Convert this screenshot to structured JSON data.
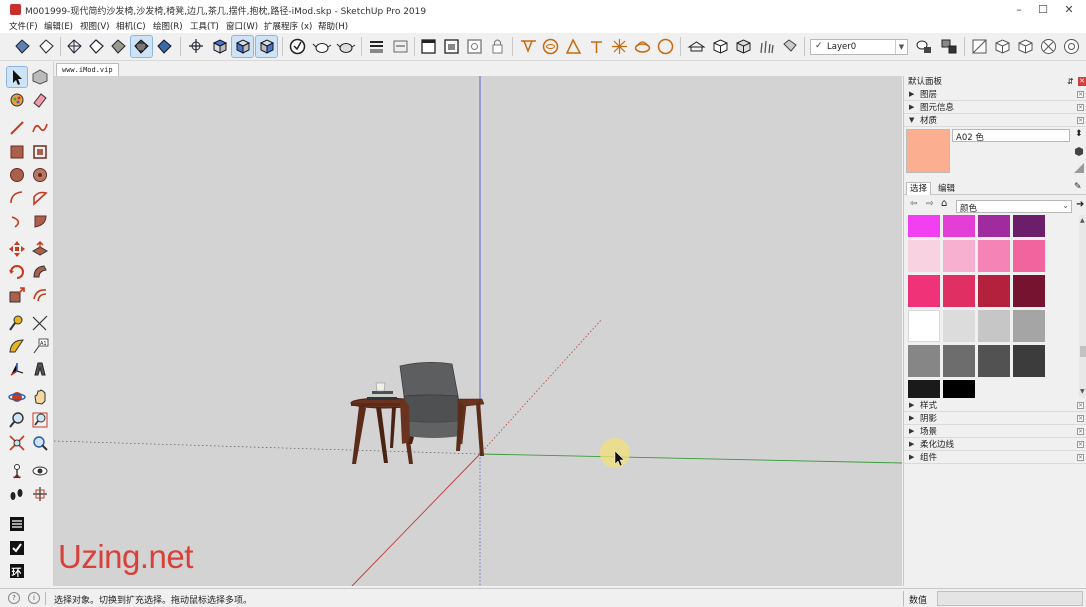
{
  "window": {
    "title": "M001999-现代简约沙发椅,沙发椅,椅凳,边几,茶几,摆件,抱枕,路径-iMod.skp - SketchUp Pro 2019",
    "minimize": "–",
    "maximize": "☐",
    "close": "✕"
  },
  "menu": [
    "文件(F)",
    "编辑(E)",
    "视图(V)",
    "相机(C)",
    "绘图(R)",
    "工具(T)",
    "窗口(W)",
    "扩展程序 (x)",
    "帮助(H)"
  ],
  "toolbar": {
    "layer_check": "✓",
    "layer_name": "Layer0"
  },
  "tab": {
    "label": "www.iMod.vip"
  },
  "watermark": "Uzing.net",
  "panel": {
    "title": "默认面板",
    "collapsed_top": [
      "图层",
      "图元信息"
    ],
    "materials_header": "材质",
    "material_name": "A02 色",
    "tabs": {
      "select": "选择",
      "edit": "编辑"
    },
    "collection": "颜色",
    "swatch_colors": [
      [
        "#f23ff2",
        "#e33ed6",
        "#a02b9f",
        "#6b1f6b"
      ],
      [
        "#f9d2e2",
        "#f7b0cf",
        "#f583b6",
        "#f2649e"
      ],
      [
        "#f03378",
        "#e02f63",
        "#b3213d",
        "#751330"
      ],
      [
        "#ffffff",
        "#dcdcdc",
        "#c6c6c6",
        "#a5a5a5"
      ],
      [
        "#868686",
        "#6d6d6d",
        "#525252",
        "#3c3c3c"
      ],
      [
        "#1a1a1a",
        "#000000"
      ]
    ],
    "material_color": "#fcae91",
    "collapsed_bottom": [
      "样式",
      "阴影",
      "场景",
      "柔化边线",
      "组件"
    ]
  },
  "status": {
    "message": "选择对象。切换到扩充选择。拖动鼠标选择多项。",
    "measure_label": "数值",
    "measure_value": ""
  },
  "colors": {
    "viewport_bg": "#d3d3d3",
    "axis_red": "#c23a3a",
    "axis_green": "#3a9a3a",
    "axis_blue": "#4a5acc",
    "watermark": "#d8413a"
  }
}
